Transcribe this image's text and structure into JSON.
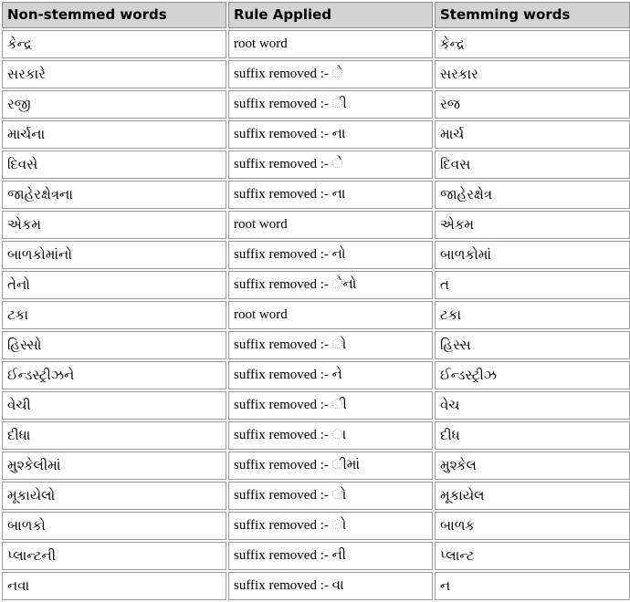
{
  "table": {
    "title": "Stemming results table",
    "headers": [
      "Non-stemmed words",
      "Rule Applied",
      "Stemming words"
    ],
    "rows": [
      {
        "non_stemmed": "કેન્દ્ર",
        "rule": "root word",
        "stemmed": "કેન્દ્ર"
      },
      {
        "non_stemmed": "સરકારે",
        "rule": "suffix removed :- ે",
        "stemmed": "સરકાર"
      },
      {
        "non_stemmed": "રજી",
        "rule": "suffix removed :- ી",
        "stemmed": "રજ"
      },
      {
        "non_stemmed": "માર્ચના",
        "rule": "suffix removed :- ના",
        "stemmed": "માર્ચ"
      },
      {
        "non_stemmed": "દિવસે",
        "rule": "suffix removed :- ે",
        "stemmed": "દિવસ"
      },
      {
        "non_stemmed": "જાહેરક્ષેત્રના",
        "rule": "suffix removed :- ના",
        "stemmed": "જાહેરક્ષેત્ર"
      },
      {
        "non_stemmed": "એકમ",
        "rule": "root word",
        "stemmed": "એકમ"
      },
      {
        "non_stemmed": "બાળકોમાંનો",
        "rule": "suffix removed :- નો",
        "stemmed": "બાળકોમાં"
      },
      {
        "non_stemmed": "તેનો",
        "rule": "suffix removed :- ેનો",
        "stemmed": "ત"
      },
      {
        "non_stemmed": "ટકા",
        "rule": "root word",
        "stemmed": "ટકા"
      },
      {
        "non_stemmed": "હિસ્સો",
        "rule": "suffix removed :- ો",
        "stemmed": "હિસ્સ"
      },
      {
        "non_stemmed": "ઈન્ડસ્ટ્રીઝને",
        "rule": "suffix removed :- ને",
        "stemmed": "ઈન્ડસ્ટ્રીઝ"
      },
      {
        "non_stemmed": "વેચી",
        "rule": "suffix removed :- ી",
        "stemmed": "વેચ"
      },
      {
        "non_stemmed": "દીધા",
        "rule": "suffix removed :- ા",
        "stemmed": "દીધ"
      },
      {
        "non_stemmed": "મુશ્કેલીમાં",
        "rule": "suffix removed :- ીમાં",
        "stemmed": "મુશ્કેલ"
      },
      {
        "non_stemmed": "મૂકાયેલો",
        "rule": "suffix removed :- ો",
        "stemmed": "મૂકાયેલ"
      },
      {
        "non_stemmed": "બાળકો",
        "rule": "suffix removed :- ો",
        "stemmed": "બાળક"
      },
      {
        "non_stemmed": "પ્લાન્ટની",
        "rule": "suffix removed :- ની",
        "stemmed": "પ્લાન્ટ"
      },
      {
        "non_stemmed": "નવા",
        "rule": "suffix removed :- વા",
        "stemmed": "ન"
      }
    ]
  },
  "colors": {
    "header_background": "#d3d3d3",
    "border": "#9a9a9a",
    "text": "#000000",
    "page_background": "#ffffff"
  }
}
